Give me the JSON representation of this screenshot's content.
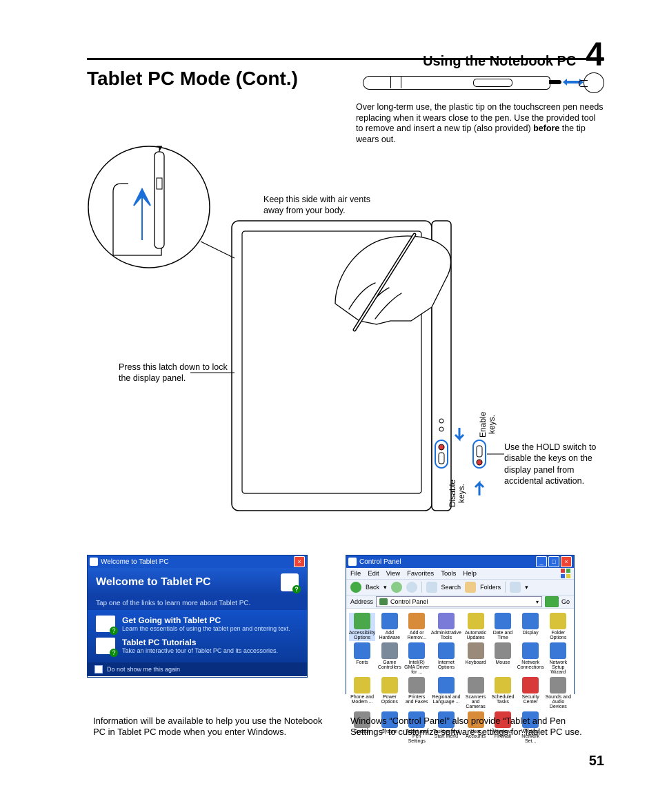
{
  "header": {
    "section": "Using the Notebook PC",
    "chapter": "4"
  },
  "title": "Tablet PC Mode (Cont.)",
  "pen_note": {
    "text": "Over long-term use, the plastic tip on the touchscreen pen needs replacing when it wears close to the pen. Use the provided tool to remove and insert a new tip (also provided) ",
    "bold": "before",
    "text2": " the tip wears out."
  },
  "labels": {
    "air": "Keep this side with air vents away from your body.",
    "latch": "Press this latch down to lock the display panel.",
    "hold": "Use the HOLD switch to disable the keys on the display panel from accidental activation.",
    "enable": "Enable keys.",
    "disable": "Disable keys."
  },
  "welcome": {
    "titlebar": "Welcome to Tablet PC",
    "heading": "Welcome to Tablet PC",
    "sub": "Tap one of the links to learn more about Tablet PC.",
    "items": [
      {
        "t": "Get Going with Tablet PC",
        "d": "Learn the essentials of using the tablet pen and entering text."
      },
      {
        "t": "Tablet PC Tutorials",
        "d": "Take an interactive tour of Tablet PC and its accessories."
      }
    ],
    "foot": "Do not show me this again"
  },
  "cp": {
    "titlebar": "Control Panel",
    "menu": [
      "File",
      "Edit",
      "View",
      "Favorites",
      "Tools",
      "Help"
    ],
    "toolbar": {
      "back": "Back",
      "search": "Search",
      "folders": "Folders"
    },
    "address_label": "Address",
    "address_value": "Control Panel",
    "go": "Go",
    "items": [
      {
        "l": "Accessibility Options",
        "c": "#4aa84a",
        "hl": true
      },
      {
        "l": "Add Hardware",
        "c": "#3a78d8"
      },
      {
        "l": "Add or Remov...",
        "c": "#d88c3a"
      },
      {
        "l": "Administrative Tools",
        "c": "#7a7ad8"
      },
      {
        "l": "Automatic Updates",
        "c": "#d8c23a"
      },
      {
        "l": "Date and Time",
        "c": "#3a78d8"
      },
      {
        "l": "Display",
        "c": "#3a78d8"
      },
      {
        "l": "Folder Options",
        "c": "#d8c23a"
      },
      {
        "l": "Fonts",
        "c": "#3a78d8"
      },
      {
        "l": "Game Controllers",
        "c": "#7a8a9a"
      },
      {
        "l": "Intel(R) GMA Driver for ...",
        "c": "#3a78d8"
      },
      {
        "l": "Internet Options",
        "c": "#3a78d8"
      },
      {
        "l": "Keyboard",
        "c": "#9a8a7a"
      },
      {
        "l": "Mouse",
        "c": "#8a8a8a"
      },
      {
        "l": "Network Connections",
        "c": "#3a78d8"
      },
      {
        "l": "Network Setup Wizard",
        "c": "#3a78d8"
      },
      {
        "l": "Phone and Modem ...",
        "c": "#d8c23a"
      },
      {
        "l": "Power Options",
        "c": "#d8c23a"
      },
      {
        "l": "Printers and Faxes",
        "c": "#8a8a8a"
      },
      {
        "l": "Regional and Language ...",
        "c": "#3a78d8"
      },
      {
        "l": "Scanners and Cameras",
        "c": "#8a8a8a"
      },
      {
        "l": "Scheduled Tasks",
        "c": "#d8c23a"
      },
      {
        "l": "Security Center",
        "c": "#d83a3a"
      },
      {
        "l": "Sounds and Audio Devices",
        "c": "#8a8a8a"
      },
      {
        "l": "Speech",
        "c": "#8a8a8a"
      },
      {
        "l": "System",
        "c": "#3a78d8"
      },
      {
        "l": "Tablet and Pen Settings",
        "c": "#3a78d8"
      },
      {
        "l": "Taskbar and Start Menu",
        "c": "#3a78d8"
      },
      {
        "l": "User Accounts",
        "c": "#d88c3a"
      },
      {
        "l": "Windows Firewall",
        "c": "#d83a3a"
      },
      {
        "l": "Wireless Network Set...",
        "c": "#3a78d8"
      }
    ]
  },
  "captions": {
    "left": "Information will be available to help you use the Notebook PC in Tablet PC mode when you enter Windows.",
    "right": "Windows “Control Panel” also provide “Tablet and Pen Settings” to customize software settings for Tablet PC use."
  },
  "page_number": "51"
}
